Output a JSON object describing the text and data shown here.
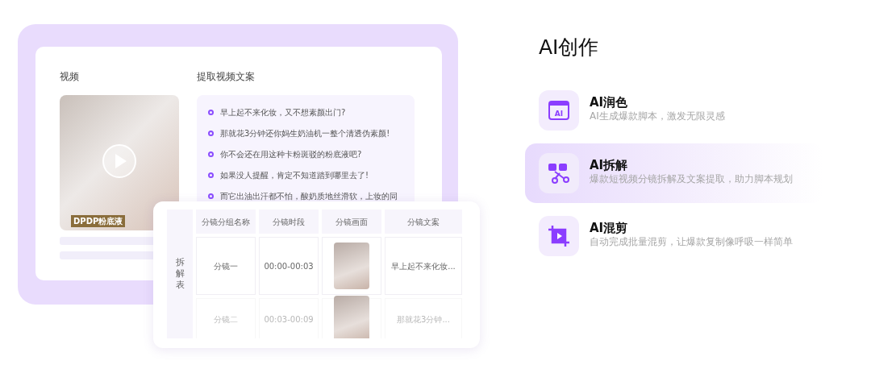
{
  "left_panel": {
    "video_heading": "视频",
    "video_caption": "DPDP粉底液",
    "script_heading": "提取视频文案",
    "script_lines": [
      "早上起不来化妆，又不想素颜出门?",
      "那就花3分钟还你妈生奶油机一整个清透伪素颜!",
      "你不会还在用这种卡粉斑驳的粉底液吧?",
      "如果没人提醒，肯定不知道踏到哪里去了!",
      "而它出油出汗都不怕，酸奶质地丝滑软，上妆的同"
    ],
    "table": {
      "side_label": "拆解表",
      "columns": [
        "分镜分组名称",
        "分镜时段",
        "分镜画面",
        "分镜文案"
      ],
      "rows": [
        {
          "name": "分镜一",
          "time": "00:00-00:03",
          "text": "早上起不来化妆...",
          "faded": false
        },
        {
          "name": "分镜二",
          "time": "00:03-00:09",
          "text": "那就花3分钟...",
          "faded": true
        }
      ]
    }
  },
  "right_panel": {
    "title": "AI创作",
    "features": [
      {
        "kind": "ai",
        "icon_label": "AI",
        "title": "AI润色",
        "desc": "AI生成爆款脚本，激发无限灵感",
        "selected": false
      },
      {
        "kind": "split",
        "title": "AI拆解",
        "desc": "爆款短视频分镜拆解及文案提取，助力脚本规划",
        "selected": true
      },
      {
        "kind": "crop",
        "title": "AI混剪",
        "desc": "自动完成批量混剪，让爆款复制像呼吸一样简单",
        "selected": false
      }
    ]
  }
}
